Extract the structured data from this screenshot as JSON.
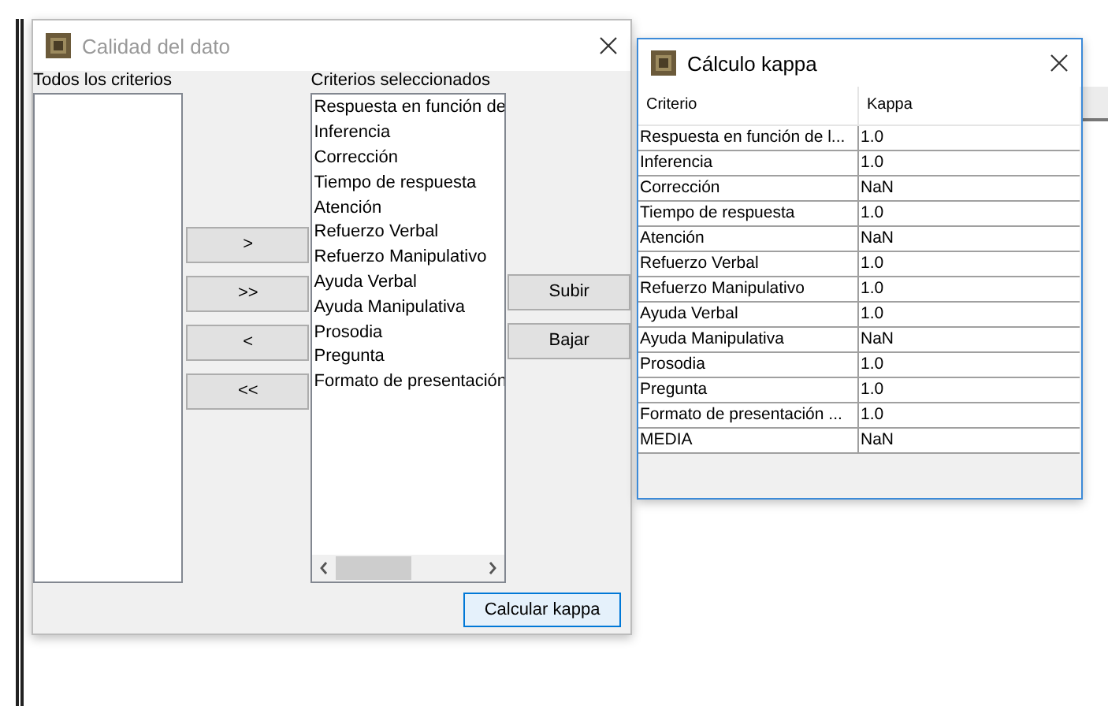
{
  "dialog": {
    "title": "Calidad del dato",
    "all_label": "Todos los criterios",
    "selected_label": "Criterios seleccionados",
    "selected_items": [
      "Respuesta en función de",
      "Inferencia",
      "Corrección",
      "Tiempo de respuesta",
      "Atención",
      "Refuerzo Verbal",
      "Refuerzo Manipulativo",
      "Ayuda Verbal",
      "Ayuda Manipulativa",
      "Prosodia",
      "Pregunta",
      "Formato de presentación"
    ],
    "move_buttons": [
      ">",
      ">>",
      "<",
      "<<"
    ],
    "order_buttons": [
      "Subir",
      "Bajar"
    ],
    "action_button": "Calcular kappa"
  },
  "result": {
    "title": "Cálculo kappa",
    "columns": [
      "Criterio",
      "Kappa"
    ],
    "rows": [
      {
        "criterio": "Respuesta en función de l...",
        "kappa": "1.0"
      },
      {
        "criterio": "Inferencia",
        "kappa": "1.0"
      },
      {
        "criterio": "Corrección",
        "kappa": "NaN"
      },
      {
        "criterio": "Tiempo de respuesta",
        "kappa": "1.0"
      },
      {
        "criterio": "Atención",
        "kappa": "NaN"
      },
      {
        "criterio": "Refuerzo Verbal",
        "kappa": "1.0"
      },
      {
        "criterio": "Refuerzo Manipulativo",
        "kappa": "1.0"
      },
      {
        "criterio": "Ayuda Verbal",
        "kappa": "1.0"
      },
      {
        "criterio": "Ayuda Manipulativa",
        "kappa": "NaN"
      },
      {
        "criterio": "Prosodia",
        "kappa": "1.0"
      },
      {
        "criterio": "Pregunta",
        "kappa": "1.0"
      },
      {
        "criterio": "Formato de presentación ...",
        "kappa": "1.0"
      },
      {
        "criterio": "MEDIA",
        "kappa": "NaN"
      }
    ]
  }
}
